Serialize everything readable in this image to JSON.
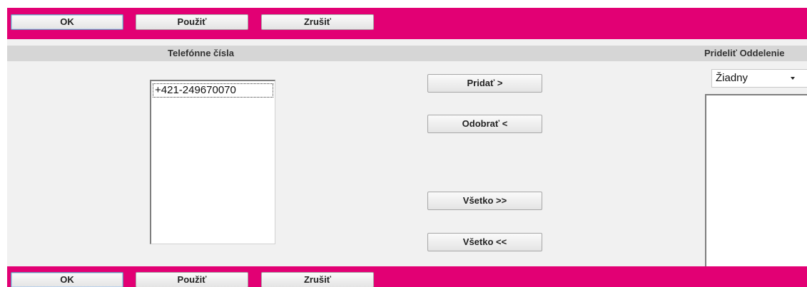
{
  "toolbar_top": {
    "ok_label": "OK",
    "apply_label": "Použiť",
    "cancel_label": "Zrušiť"
  },
  "toolbar_bottom": {
    "ok_label": "OK",
    "apply_label": "Použiť",
    "cancel_label": "Zrušiť"
  },
  "headers": {
    "phones": "Telefónne čísla",
    "assign": "Prideliť Oddelenie"
  },
  "phone_list": {
    "items": [
      "+421-249670070"
    ]
  },
  "actions": {
    "add": "Pridať >",
    "remove": "Odobrať <",
    "add_all": "Všetko >>",
    "remove_all": "Všetko <<"
  },
  "department_select": {
    "selected": "Žiadny"
  },
  "colors": {
    "brand_bar": "#e20074",
    "panel_bg": "#f1f1f1",
    "header_bg": "#d6d6d6"
  }
}
